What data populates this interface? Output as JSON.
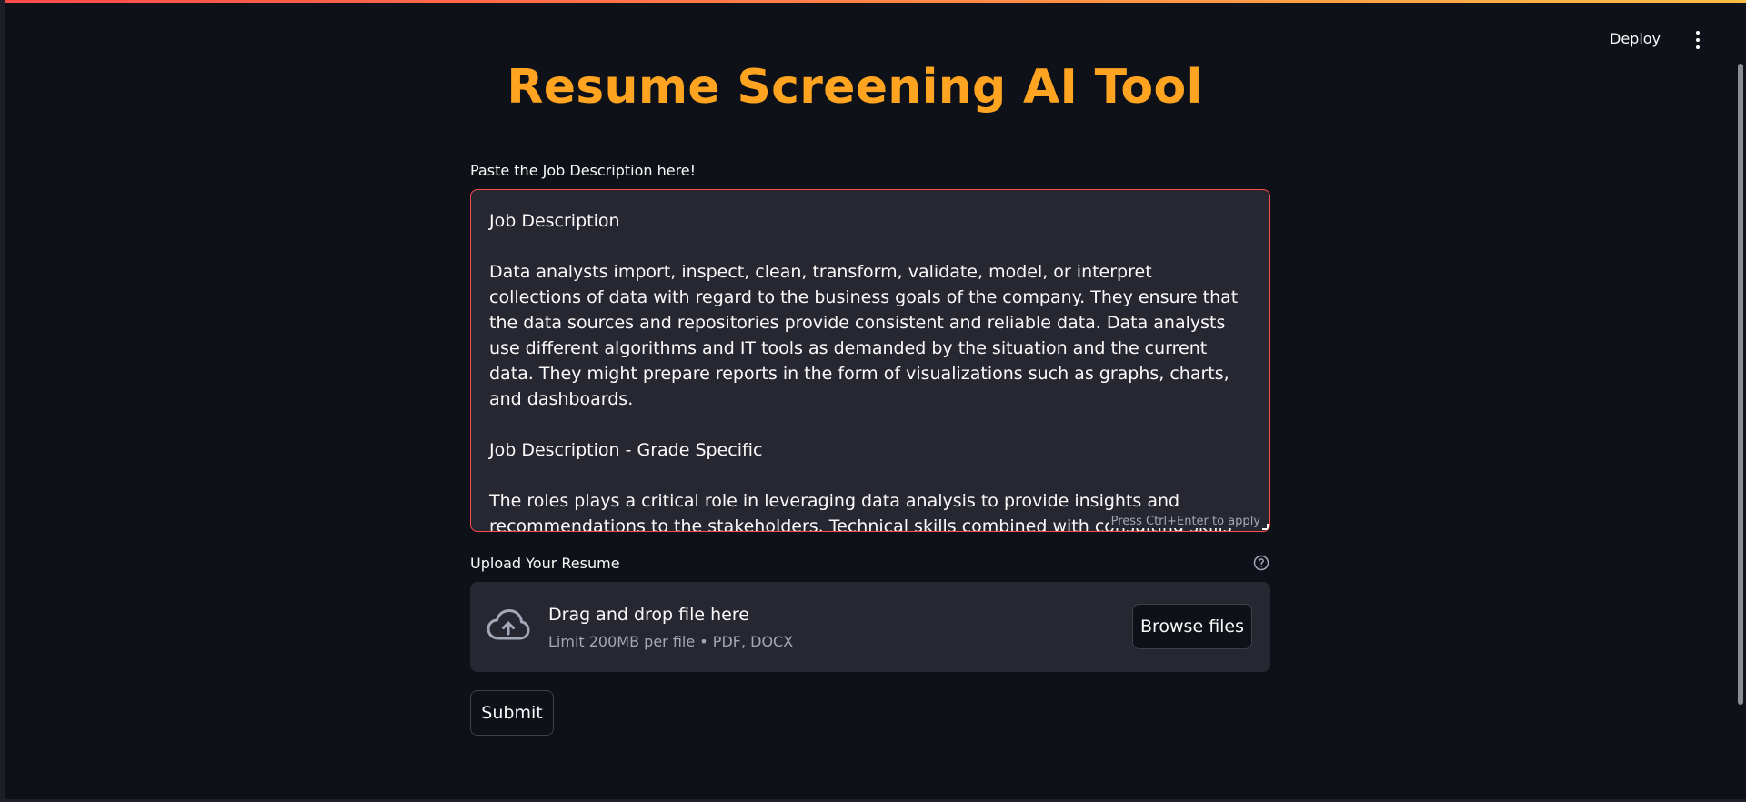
{
  "header": {
    "deploy_label": "Deploy",
    "menu_icon": "more-vertical-icon"
  },
  "main": {
    "title": "Resume Screening AI Tool",
    "title_color": "#ffa421",
    "job_description": {
      "label": "Paste the Job Description here!",
      "value": "Job Description\n\nData analysts import, inspect, clean, transform, validate, model, or interpret collections of data with regard to the business goals of the company. They ensure that the data sources and repositories provide consistent and reliable data. Data analysts use different algorithms and IT tools as demanded by the situation and the current data. They might prepare reports in the form of visualizations such as graphs, charts, and dashboards.\n\nJob Description - Grade Specific\n\nThe roles plays a critical role in leveraging data analysis to provide insights and recommendations to the stakeholders. Technical skills combined with consulting skills to support decision-making, drive business growth, and deliver value through data-driven insights.",
      "hint": "Press Ctrl+Enter to apply",
      "border_color": "#ff4b4b"
    },
    "upload": {
      "label": "Upload Your Resume",
      "help_icon": "question-circle-icon",
      "cloud_icon": "cloud-upload-icon",
      "drop_title": "Drag and drop file here",
      "drop_subtitle": "Limit 200MB per file • PDF, DOCX",
      "browse_label": "Browse files"
    },
    "submit_label": "Submit"
  },
  "theme": {
    "background": "#0e1117",
    "panel": "#262730",
    "accent_red": "#ff4b4b",
    "accent_yellow": "#ffbd45"
  }
}
